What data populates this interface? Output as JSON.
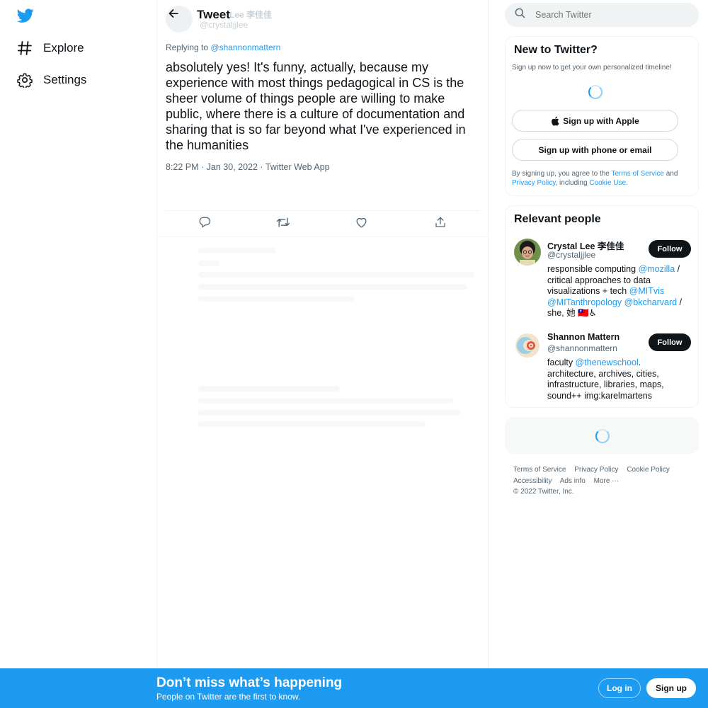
{
  "nav": {
    "explore_label": "Explore",
    "settings_label": "Settings"
  },
  "header": {
    "title": "Tweet",
    "faded_name": "Lee 李佳佳",
    "faded_handle": "@crystaljjlee"
  },
  "tweet": {
    "replying_prefix": "Replying to",
    "replying_handle": "@shannonmattern",
    "text": "absolutely yes! It's funny, actually, because my experience with most things pedagogical in CS is the sheer volume of things people are willing to make public, where there is a culture of documentation and sharing that is so far beyond what I've experienced in the humanities",
    "meta": "8:22 PM · Jan 30, 2022 · Twitter Web App"
  },
  "search": {
    "placeholder": "Search Twitter"
  },
  "new_to_twitter": {
    "title": "New to Twitter?",
    "subtitle": "Sign up now to get your own personalized timeline!",
    "apple_label": "Sign up with Apple",
    "phone_label": "Sign up with phone or email",
    "terms_prefix": "By signing up, you agree to the",
    "terms_link": "Terms of Service",
    "terms_and": "and",
    "privacy_link": "Privacy Policy",
    "including": ", including",
    "cookie_link": "Cookie Use."
  },
  "relevant_people": {
    "title": "Relevant people",
    "follow_label": "Follow",
    "people": [
      {
        "name": "Crystal Lee 李佳佳",
        "handle": "@crystaljjlee",
        "bio_1": "responsible computing",
        "bio_link_1": "@mozilla",
        "bio_2": "/ critical approaches to data visualizations + tech",
        "bio_link_2": "@MITvis",
        "bio_link_3": "@MITanthropology",
        "bio_link_4": "@bkcharvard",
        "bio_3": "/ she, 她 🇹🇼♿"
      },
      {
        "name": "Shannon Mattern",
        "handle": "@shannonmattern",
        "bio_1": "faculty",
        "bio_link_1": "@thenewschool",
        "bio_2": ". architecture, archives, cities, infrastructure, libraries, maps, sound++ img:karelmartens"
      }
    ]
  },
  "footer": {
    "terms": "Terms of Service",
    "privacy": "Privacy Policy",
    "cookie": "Cookie Policy",
    "accessibility": "Accessibility",
    "ads": "Ads info",
    "more": "More ···",
    "copyright": "© 2022 Twitter, Inc."
  },
  "bottom_bar": {
    "title": "Don’t miss what’s happening",
    "subtitle": "People on Twitter are the first to know.",
    "login_label": "Log in",
    "signup_label": "Sign up"
  },
  "colors": {
    "brand": "#1d9bf0",
    "text": "#0f1419",
    "muted": "#536471"
  }
}
